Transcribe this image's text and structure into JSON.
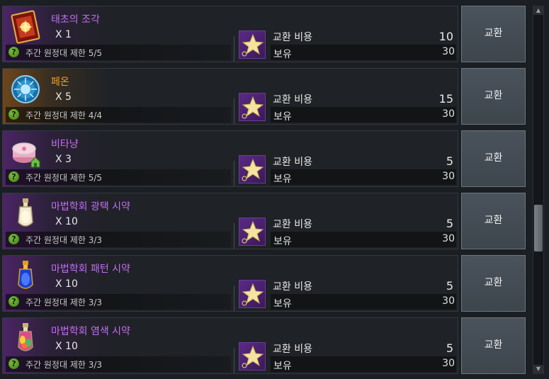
{
  "items": [
    {
      "name": "태초의 조각",
      "name_color": "purple",
      "qty": "X 1",
      "limit": "주간 원정대 제한 5/5",
      "cost_label": "교환 비용",
      "cost": "10",
      "own_label": "보유",
      "own": "30",
      "button": "교환",
      "icon": "card-icon"
    },
    {
      "name": "페온",
      "name_color": "orange",
      "qty": "X 5",
      "limit": "주간 원정대 제한 4/4",
      "cost_label": "교환 비용",
      "cost": "15",
      "own_label": "보유",
      "own": "30",
      "button": "교환",
      "icon": "peon-orb-icon"
    },
    {
      "name": "비타냥",
      "name_color": "purple",
      "qty": "X 3",
      "limit": "주간 원정대 제한 5/5",
      "cost_label": "교환 비용",
      "cost": "5",
      "own_label": "보유",
      "own": "30",
      "button": "교환",
      "icon": "cat-food-can-icon"
    },
    {
      "name": "마법학회 광택 시약",
      "name_color": "purple",
      "qty": "X 10",
      "limit": "주간 원정대 제한 3/3",
      "cost_label": "교환 비용",
      "cost": "5",
      "own_label": "보유",
      "own": "30",
      "button": "교환",
      "icon": "potion-gloss-icon"
    },
    {
      "name": "마법학회 패턴 시약",
      "name_color": "purple",
      "qty": "X 10",
      "limit": "주간 원정대 제한 3/3",
      "cost_label": "교환 비용",
      "cost": "5",
      "own_label": "보유",
      "own": "30",
      "button": "교환",
      "icon": "potion-pattern-icon"
    },
    {
      "name": "마법학회 염색 시약",
      "name_color": "purple",
      "qty": "X 10",
      "limit": "주간 원정대 제한 3/3",
      "cost_label": "교환 비용",
      "cost": "5",
      "own_label": "보유",
      "own": "30",
      "button": "교환",
      "icon": "potion-dye-icon"
    }
  ],
  "question_mark": "?",
  "currency_icon": "star-currency-icon",
  "scrollbar": {
    "up": "▲",
    "down": "▼"
  },
  "colors": {
    "purple": "#c26ef0",
    "orange": "#f0a020",
    "button": "#444c54",
    "question": "#5fa322"
  }
}
